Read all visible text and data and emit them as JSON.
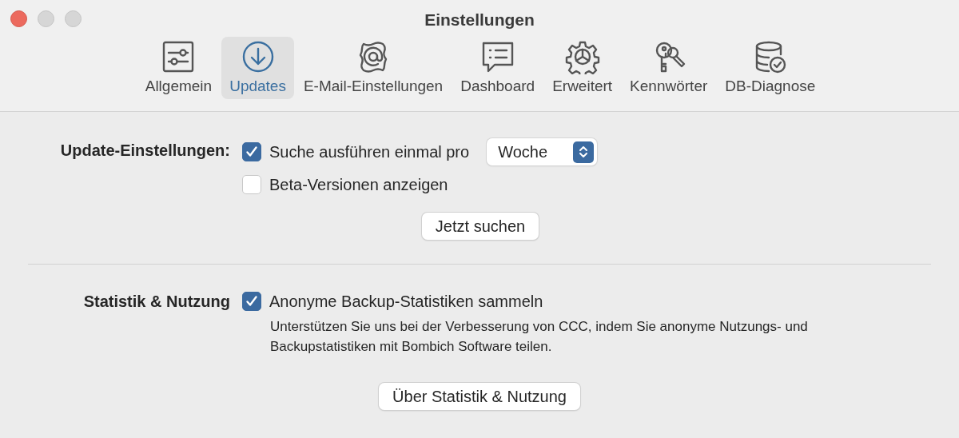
{
  "window": {
    "title": "Einstellungen"
  },
  "tabs": [
    {
      "label": "Allgemein",
      "kind": "sliders",
      "selected": false
    },
    {
      "label": "Updates",
      "kind": "download",
      "selected": true
    },
    {
      "label": "E-Mail-Einstellungen",
      "kind": "at",
      "selected": false
    },
    {
      "label": "Dashboard",
      "kind": "chat",
      "selected": false
    },
    {
      "label": "Erweitert",
      "kind": "gear",
      "selected": false
    },
    {
      "label": "Kennwörter",
      "kind": "keys",
      "selected": false
    },
    {
      "label": "DB-Diagnose",
      "kind": "database",
      "selected": false
    }
  ],
  "update_settings": {
    "label": "Update-Einstellungen:",
    "options": [
      {
        "label": "Suche ausführen einmal pro",
        "checked": true,
        "select": {
          "value": "Woche"
        }
      },
      {
        "label": "Beta-Versionen anzeigen",
        "checked": false
      }
    ],
    "button": "Jetzt suchen"
  },
  "statistics": {
    "label": "Statistik & Nutzung",
    "option": {
      "label": "Anonyme Backup-Statistiken sammeln",
      "checked": true
    },
    "description": "Unterstützen Sie uns bei der Verbesserung von CCC, indem Sie anonyme Nutzungs- und Backupstatistiken mit Bombich Software teilen.",
    "button": "Über Statistik & Nutzung"
  }
}
